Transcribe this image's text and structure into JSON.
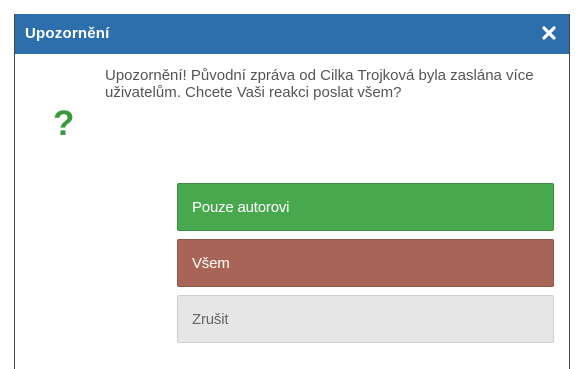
{
  "dialog": {
    "title": "Upozornění",
    "close_icon": "close-icon",
    "question_icon": "?",
    "message": "Upozornění! Původní zpráva od Cilka Trojková byla zaslána více uživatelům. Chcete Vaši reakci poslat všem?",
    "buttons": {
      "author": "Pouze autorovi",
      "all": "Všem",
      "cancel": "Zrušit"
    }
  },
  "colors": {
    "titlebar": "#2d6fad",
    "author_button": "#48a84e",
    "all_button": "#a86557",
    "cancel_button": "#e6e6e6",
    "question_icon": "#3a9a3a"
  }
}
